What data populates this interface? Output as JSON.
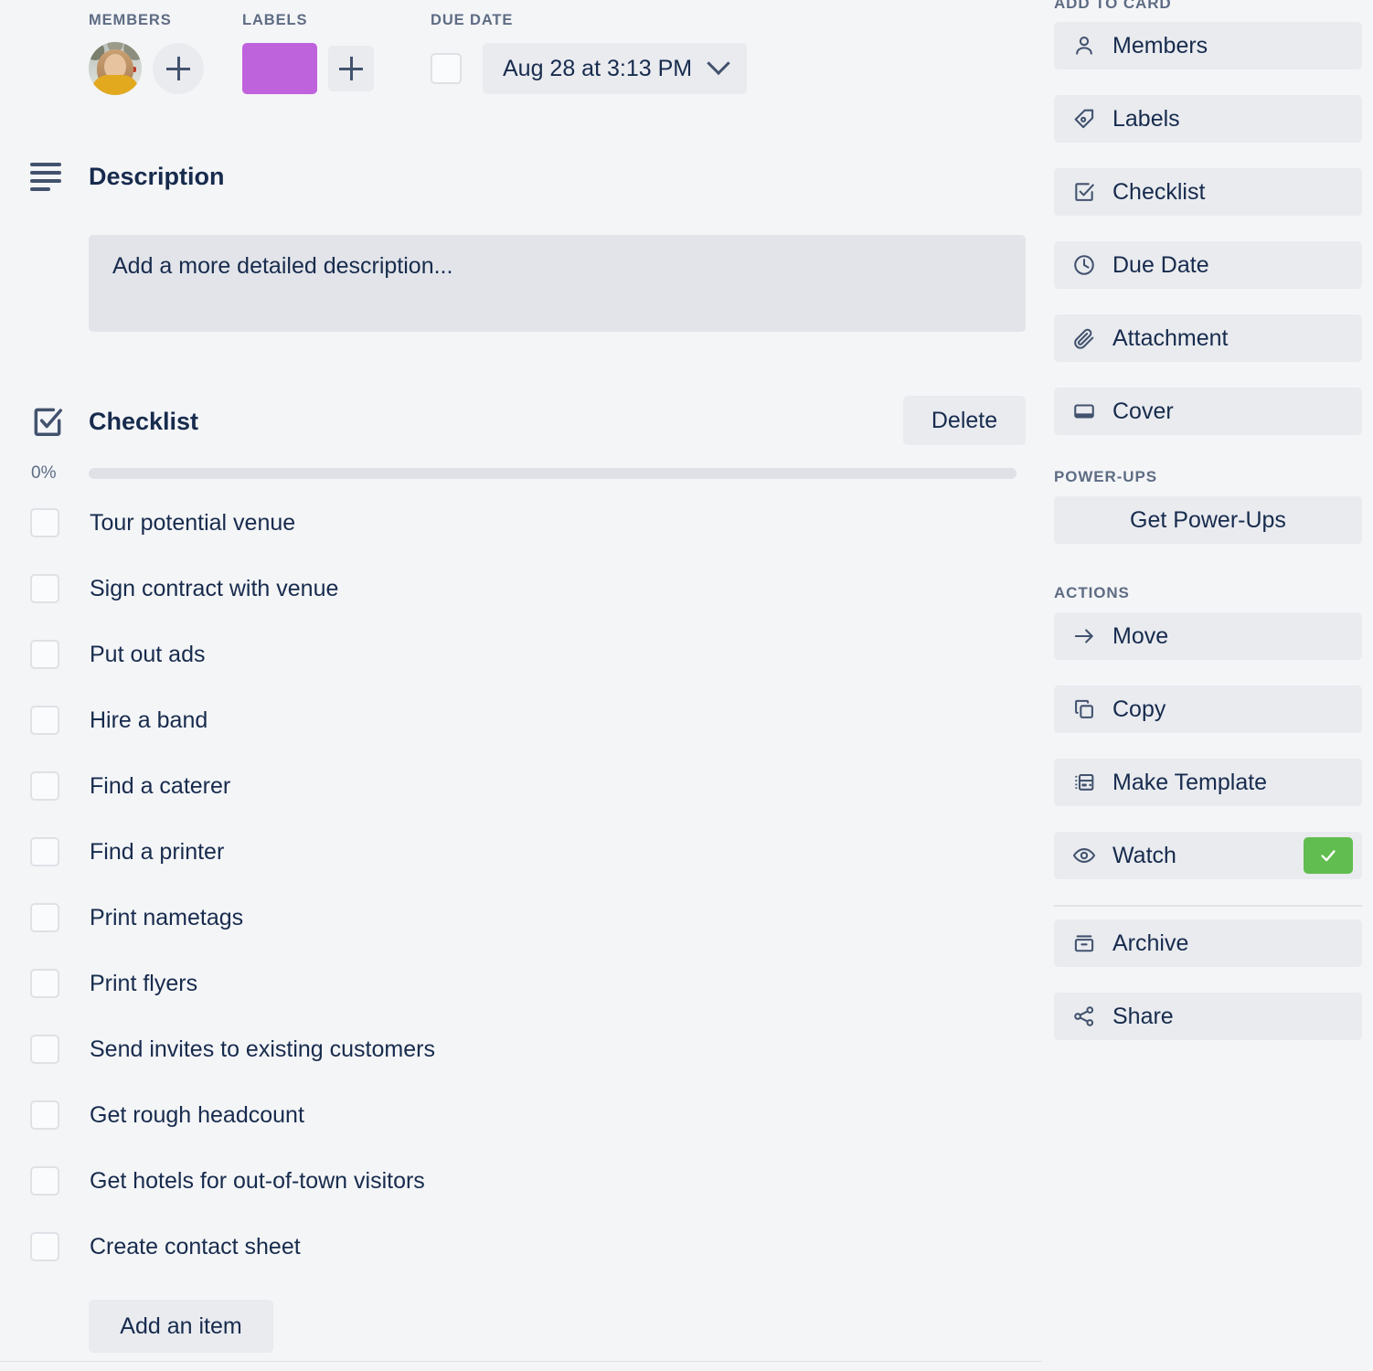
{
  "attributes": {
    "members": {
      "label": "MEMBERS",
      "avatar_name": "member-avatar",
      "add_label": "+"
    },
    "labels": {
      "label": "LABELS",
      "chip_color": "#bf63dd",
      "add_label": "+"
    },
    "due_date": {
      "label": "DUE DATE",
      "value": "Aug 28 at 3:13 PM",
      "checked": false
    }
  },
  "description": {
    "title": "Description",
    "placeholder": "Add a more detailed description..."
  },
  "checklist": {
    "title": "Checklist",
    "delete_label": "Delete",
    "progress_text": "0%",
    "progress_value": 0,
    "add_item_label": "Add an item",
    "items": [
      {
        "text": "Tour potential venue",
        "checked": false
      },
      {
        "text": "Sign contract with venue",
        "checked": false
      },
      {
        "text": "Put out ads",
        "checked": false
      },
      {
        "text": "Hire a band",
        "checked": false
      },
      {
        "text": "Find a caterer",
        "checked": false
      },
      {
        "text": "Find a printer",
        "checked": false
      },
      {
        "text": "Print nametags",
        "checked": false
      },
      {
        "text": "Print flyers",
        "checked": false
      },
      {
        "text": "Send invites to existing customers",
        "checked": false
      },
      {
        "text": "Get rough headcount",
        "checked": false
      },
      {
        "text": "Get hotels for out-of-town visitors",
        "checked": false
      },
      {
        "text": "Create contact sheet",
        "checked": false
      }
    ]
  },
  "sidebar": {
    "add_to_card": {
      "heading": "ADD TO CARD",
      "items": [
        {
          "label": "Members",
          "icon": "person-icon"
        },
        {
          "label": "Labels",
          "icon": "tag-icon"
        },
        {
          "label": "Checklist",
          "icon": "check-square-icon"
        },
        {
          "label": "Due Date",
          "icon": "clock-icon"
        },
        {
          "label": "Attachment",
          "icon": "paperclip-icon"
        },
        {
          "label": "Cover",
          "icon": "cover-icon"
        }
      ]
    },
    "power_ups": {
      "heading": "POWER-UPS",
      "button_label": "Get Power-Ups"
    },
    "actions": {
      "heading": "ACTIONS",
      "items": [
        {
          "label": "Move",
          "icon": "arrow-right-icon",
          "badge": null
        },
        {
          "label": "Copy",
          "icon": "copy-icon",
          "badge": null
        },
        {
          "label": "Make Template",
          "icon": "template-icon",
          "badge": null
        },
        {
          "label": "Watch",
          "icon": "eye-icon",
          "badge": "check"
        },
        {
          "label": "Archive",
          "icon": "archive-icon",
          "badge": null
        },
        {
          "label": "Share",
          "icon": "share-icon",
          "badge": null
        }
      ]
    }
  },
  "colors": {
    "page_background": "#f4f5f7",
    "button_background": "#e9ebef",
    "description_background": "#e2e4e9",
    "text": "#172b4d",
    "muted_text": "#5e6c84",
    "label_purple": "#bf63dd",
    "watch_green": "#61bd4f"
  }
}
